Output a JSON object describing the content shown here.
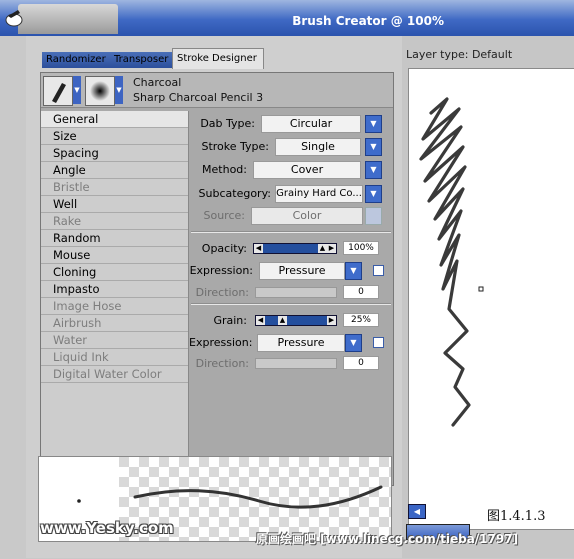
{
  "window": {
    "title": "Brush Creator @ 100%"
  },
  "tabs": [
    {
      "label": "Randomizer",
      "active": false
    },
    {
      "label": "Transposer",
      "active": false
    },
    {
      "label": "Stroke Designer",
      "active": true
    }
  ],
  "variant": {
    "category": "Charcoal",
    "variant": "Sharp Charcoal Pencil 3"
  },
  "categories": [
    {
      "label": "General",
      "enabled": true,
      "selected": true
    },
    {
      "label": "Size",
      "enabled": true
    },
    {
      "label": "Spacing",
      "enabled": true
    },
    {
      "label": "Angle",
      "enabled": true
    },
    {
      "label": "Bristle",
      "enabled": false
    },
    {
      "label": "Well",
      "enabled": true
    },
    {
      "label": "Rake",
      "enabled": false
    },
    {
      "label": "Random",
      "enabled": true
    },
    {
      "label": "Mouse",
      "enabled": true
    },
    {
      "label": "Cloning",
      "enabled": true
    },
    {
      "label": "Impasto",
      "enabled": true
    },
    {
      "label": "Image Hose",
      "enabled": false
    },
    {
      "label": "Airbrush",
      "enabled": false
    },
    {
      "label": "Water",
      "enabled": false
    },
    {
      "label": "Liquid Ink",
      "enabled": false
    },
    {
      "label": "Digital Water Color",
      "enabled": false
    }
  ],
  "settings": {
    "dab_type": {
      "label": "Dab Type:",
      "value": "Circular"
    },
    "stroke_type": {
      "label": "Stroke Type:",
      "value": "Single"
    },
    "method": {
      "label": "Method:",
      "value": "Cover"
    },
    "subcategory": {
      "label": "Subcategory:",
      "value": "Grainy Hard Co..."
    },
    "source": {
      "label": "Source:",
      "value": "Color"
    },
    "opacity": {
      "label": "Opacity:",
      "value": "100%",
      "level": 1.0
    },
    "opacity_expression": {
      "label": "Expression:",
      "value": "Pressure"
    },
    "opacity_direction": {
      "label": "Direction:",
      "value": "0"
    },
    "grain": {
      "label": "Grain:",
      "value": "25%",
      "level": 0.25
    },
    "grain_expression": {
      "label": "Expression:",
      "value": "Pressure"
    },
    "grain_direction": {
      "label": "Direction:",
      "value": "0"
    }
  },
  "canvas": {
    "layer_type": "Layer type: Default",
    "figure_label": "图1.4.1.3"
  },
  "watermarks": {
    "left": "www.Yesky.com",
    "right": "原画绘画吧 [www.linecg.com/tieba/1797]"
  },
  "colors": {
    "title_bar": "#3f69c4",
    "accent": "#3f6ccb",
    "stroke": "#333333"
  }
}
